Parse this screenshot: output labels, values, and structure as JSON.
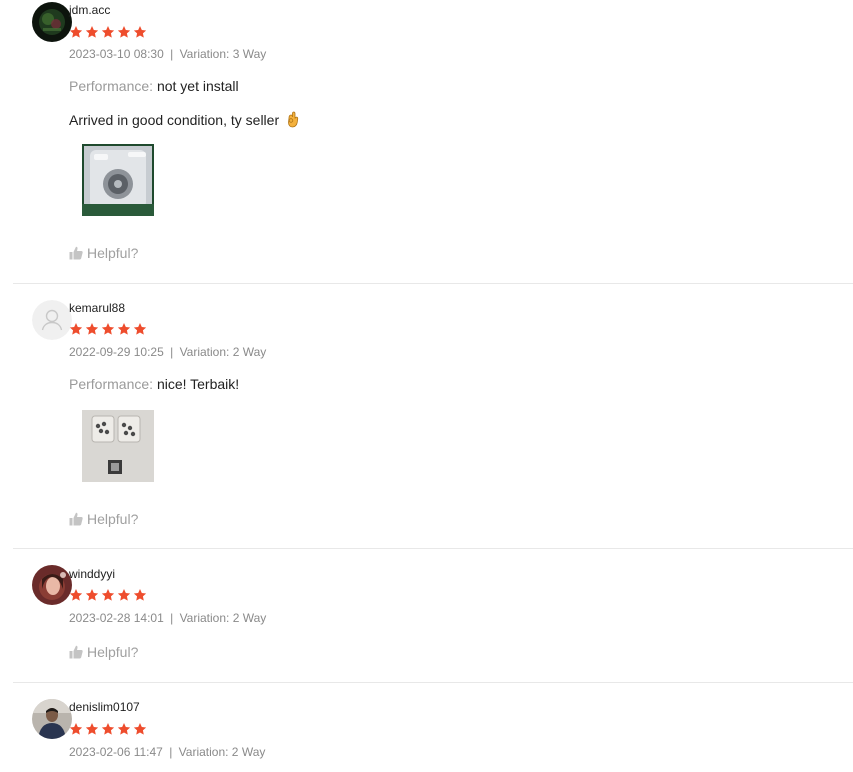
{
  "colors": {
    "star": "#ee4d2d",
    "meta_text": "#8a8a8a",
    "label_text": "#9a9a9a",
    "divider": "#e8e8e8"
  },
  "reviews": [
    {
      "username": "jdm.acc",
      "rating": 5,
      "date": "2023-03-10 08:30",
      "separator": "|",
      "variation": "Variation: 3 Way",
      "performance_label": "Performance:",
      "performance_value": "not yet install",
      "comment": "Arrived in good condition, ty seller",
      "comment_emoji": "ok-hand-emoji",
      "helpful": "Helpful?"
    },
    {
      "username": "kemarul88",
      "rating": 5,
      "date": "2022-09-29 10:25",
      "separator": "|",
      "variation": "Variation: 2 Way",
      "performance_label": "Performance:",
      "performance_value": "nice! Terbaik!",
      "helpful": "Helpful?"
    },
    {
      "username": "winddyyi",
      "rating": 5,
      "date": "2023-02-28 14:01",
      "separator": "|",
      "variation": "Variation: 2 Way",
      "helpful": "Helpful?"
    },
    {
      "username": "denislim0107",
      "rating": 5,
      "date": "2023-02-06 11:47",
      "separator": "|",
      "variation": "Variation: 2 Way"
    }
  ]
}
